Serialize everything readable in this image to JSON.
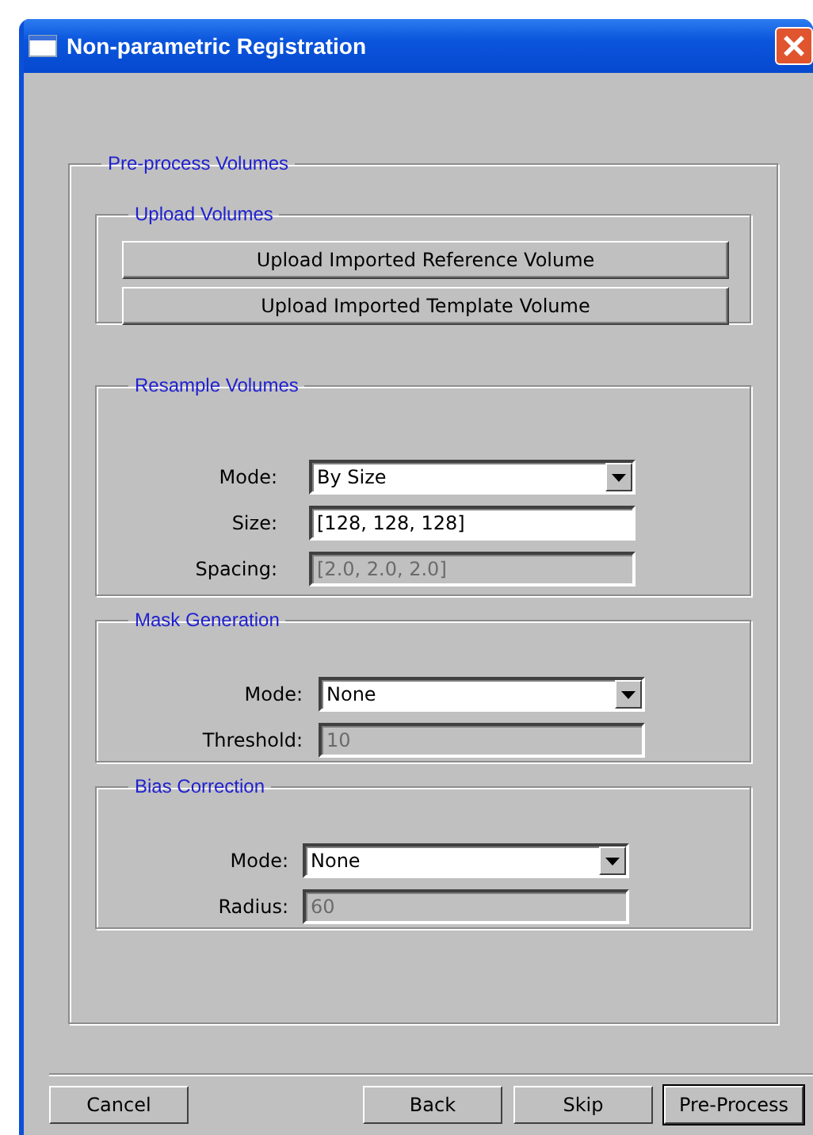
{
  "window": {
    "title": "Non-parametric Registration"
  },
  "main_group": {
    "title": "Pre-process Volumes",
    "groups": [
      {
        "title": "Upload Volumes",
        "buttons": [
          "Upload Imported Reference Volume",
          "Upload Imported Template Volume"
        ]
      },
      {
        "title": "Resample Volumes",
        "fields": [
          {
            "kind": "select",
            "label": "Mode:",
            "value": "By Size",
            "disabled": false
          },
          {
            "kind": "text",
            "label": "Size:",
            "value": "[128, 128, 128]",
            "disabled": false
          },
          {
            "kind": "text",
            "label": "Spacing:",
            "value": "[2.0, 2.0, 2.0]",
            "disabled": true
          }
        ]
      },
      {
        "title": "Mask Generation",
        "fields": [
          {
            "kind": "select",
            "label": "Mode:",
            "value": "None",
            "disabled": false
          },
          {
            "kind": "text",
            "label": "Threshold:",
            "value": "10",
            "disabled": true
          }
        ]
      },
      {
        "title": "Bias Correction",
        "fields": [
          {
            "kind": "select",
            "label": "Mode:",
            "value": "None",
            "disabled": false
          },
          {
            "kind": "text",
            "label": "Radius:",
            "value": "60",
            "disabled": true
          }
        ]
      }
    ]
  },
  "footer_buttons": [
    {
      "label": "Cancel",
      "default": false
    },
    {
      "label": "Back",
      "default": false
    },
    {
      "label": "Skip",
      "default": false
    },
    {
      "label": "Pre-Process",
      "default": true
    }
  ]
}
